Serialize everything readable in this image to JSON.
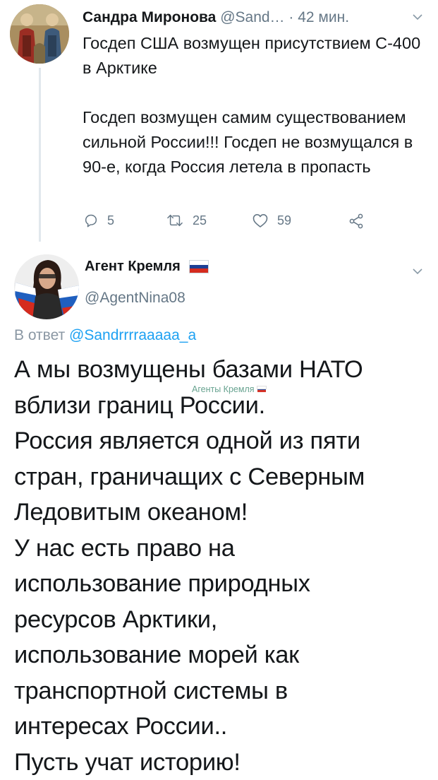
{
  "tweet1": {
    "author_name": "Сандра Миронова",
    "author_handle": "@Sand…",
    "time": "· 42 мин.",
    "paragraphs": [
      "Госдеп США возмущен присутствием С-400 в Арктике",
      "Госдеп возмущен самим существованием сильной России!!! Госдеп не возмущался в 90-е, когда Россия летела в пропасть"
    ],
    "actions": {
      "replies": "5",
      "retweets": "25",
      "likes": "59"
    }
  },
  "tweet2": {
    "author_name": "Агент Кремля",
    "author_flag_icon": "russian-flag-icon",
    "author_handle": "@AgentNina08",
    "reply_prefix": "В ответ",
    "reply_to_handle": "@Sandrrrraaaaa_a",
    "lines": [
      "А мы возмущены базами НАТО",
      "вблизи границ России.",
      "Россия является одной из пяти",
      "стран, граничащих с Северным",
      "Ледовитым океаном!",
      "У нас есть право на",
      "использование природных",
      "ресурсов Арктики,",
      "использование морей как",
      "транспортной системы в",
      "интересах России..",
      "Пусть учат историю!"
    ]
  },
  "watermark": {
    "text": "Агенты Кремля",
    "flag_icon": "russian-flag-icon"
  },
  "colors": {
    "text": "#14171a",
    "secondary": "#657786",
    "link": "#1da1f2",
    "divider": "#e1e8ed",
    "flag_white": "#ffffff",
    "flag_blue": "#1c3f94",
    "flag_red": "#d52b1e"
  }
}
